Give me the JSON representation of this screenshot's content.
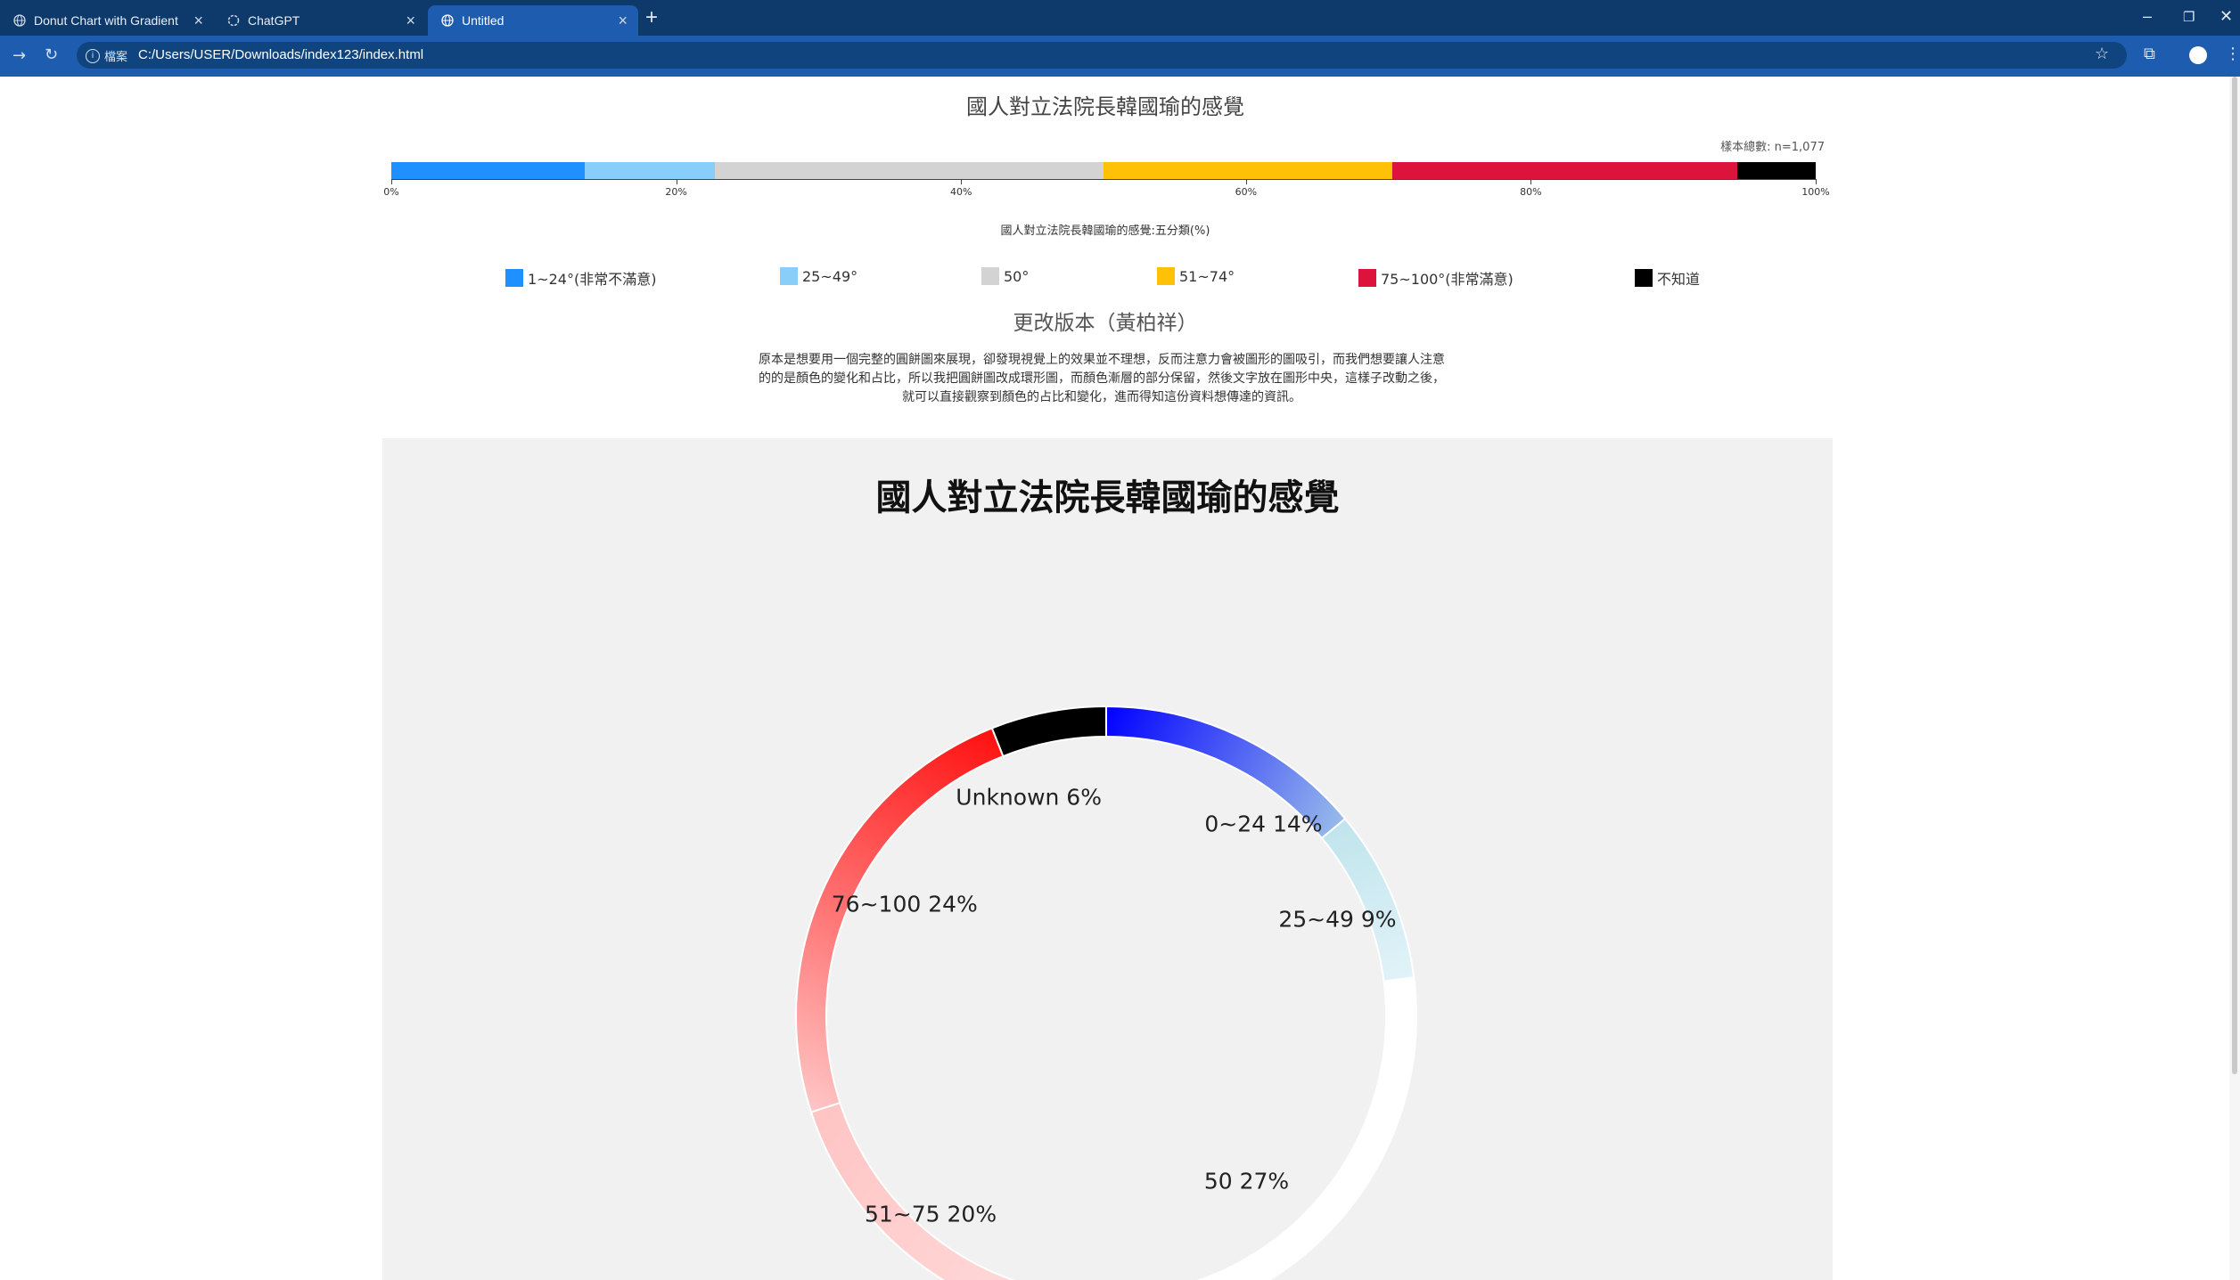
{
  "browser": {
    "tabs": [
      {
        "title": "Donut Chart with Gradient",
        "active": false
      },
      {
        "title": "ChatGPT",
        "active": false
      },
      {
        "title": "Untitled",
        "active": true
      }
    ],
    "site_chip": "檔案",
    "url": "C:/Users/USER/Downloads/index123/index.html",
    "accent": "#1d5cae"
  },
  "original": {
    "title": "國人對立法院長韓國瑜的感覺",
    "sample_note": "樣本總數: n=1,077",
    "axis_title": "國人對立法院長韓國瑜的感覺:五分類(%)"
  },
  "redesign": {
    "section_title": "更改版本（黃柏祥）",
    "description_lines": [
      "原本是想要用一個完整的圓餅圖來展現，卻發現視覺上的效果並不理想，反而注意力會被圖形的圖吸引，而我們想要讓人注意",
      "的的是顏色的變化和占比，所以我把圓餅圖改成環形圖，而顏色漸層的部分保留，然後文字放在圖形中央，這樣子改動之後，",
      "就可以直接觀察到顏色的占比和變化，進而得知這份資料想傳達的資訊。"
    ],
    "chart_title": "國人對立法院長韓國瑜的感覺"
  },
  "chart_data": [
    {
      "type": "bar",
      "stacked": true,
      "orientation": "horizontal",
      "title": "國人對立法院長韓國瑜的感覺",
      "xlabel": "國人對立法院長韓國瑜的感覺:五分類(%)",
      "xlim": [
        0,
        100
      ],
      "x_ticks": [
        "0%",
        "20%",
        "40%",
        "60%",
        "80%",
        "100%"
      ],
      "series": [
        {
          "name": "1~24°(非常不滿意)",
          "value": 13.6,
          "color": "#1e90ff"
        },
        {
          "name": "25~49°",
          "value": 9.1,
          "color": "#87cefa"
        },
        {
          "name": "50°",
          "value": 27.3,
          "color": "#d3d3d3"
        },
        {
          "name": "51~74°",
          "value": 20.3,
          "color": "#ffc107"
        },
        {
          "name": "75~100°(非常滿意)",
          "value": 24.2,
          "color": "#dc143c"
        },
        {
          "name": "不知道",
          "value": 5.5,
          "color": "#000000"
        }
      ]
    },
    {
      "type": "pie",
      "variant": "donut",
      "title": "國人對立法院長韓國瑜的感覺",
      "slices": [
        {
          "label": "0~24 14%",
          "value": 14,
          "color_start": "#0000ff",
          "color_end": "#99bbea"
        },
        {
          "label": "25~49 9%",
          "value": 9,
          "color_start": "#c0e4ec",
          "color_end": "#e2f3f9"
        },
        {
          "label": "50 27%",
          "value": 27,
          "color_start": "#ffffff",
          "color_end": "#ffffff"
        },
        {
          "label": "51~75 20%",
          "value": 20,
          "color_start": "#ffdede",
          "color_end": "#ffc4c4"
        },
        {
          "label": "76~100 24%",
          "value": 24,
          "color_start": "#ffc6c6",
          "color_end": "#ff1010"
        },
        {
          "label": "Unknown 6%",
          "value": 6,
          "color_start": "#000000",
          "color_end": "#000000"
        }
      ]
    }
  ]
}
